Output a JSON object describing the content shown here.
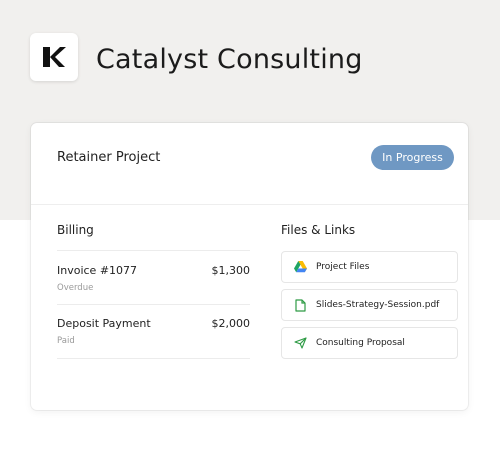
{
  "company": {
    "name": "Catalyst Consulting",
    "logo_icon": "catalyst-k-logo"
  },
  "project": {
    "title": "Retainer Project",
    "status": "In Progress",
    "status_color": "#6f98c3"
  },
  "billing": {
    "title": "Billing",
    "items": [
      {
        "name": "Invoice #1077",
        "amount": "$1,300",
        "status": "Overdue"
      },
      {
        "name": "Deposit Payment",
        "amount": "$2,000",
        "status": "Paid"
      }
    ]
  },
  "files": {
    "title": "Files & Links",
    "items": [
      {
        "label": "Project Files",
        "icon": "google-drive-icon"
      },
      {
        "label": "Slides-Strategy-Session.pdf",
        "icon": "document-icon"
      },
      {
        "label": "Consulting Proposal",
        "icon": "send-icon"
      }
    ]
  },
  "colors": {
    "top_band": "#f1f0ee",
    "accent": "#6f98c3",
    "doc_green": "#2e9b45"
  }
}
